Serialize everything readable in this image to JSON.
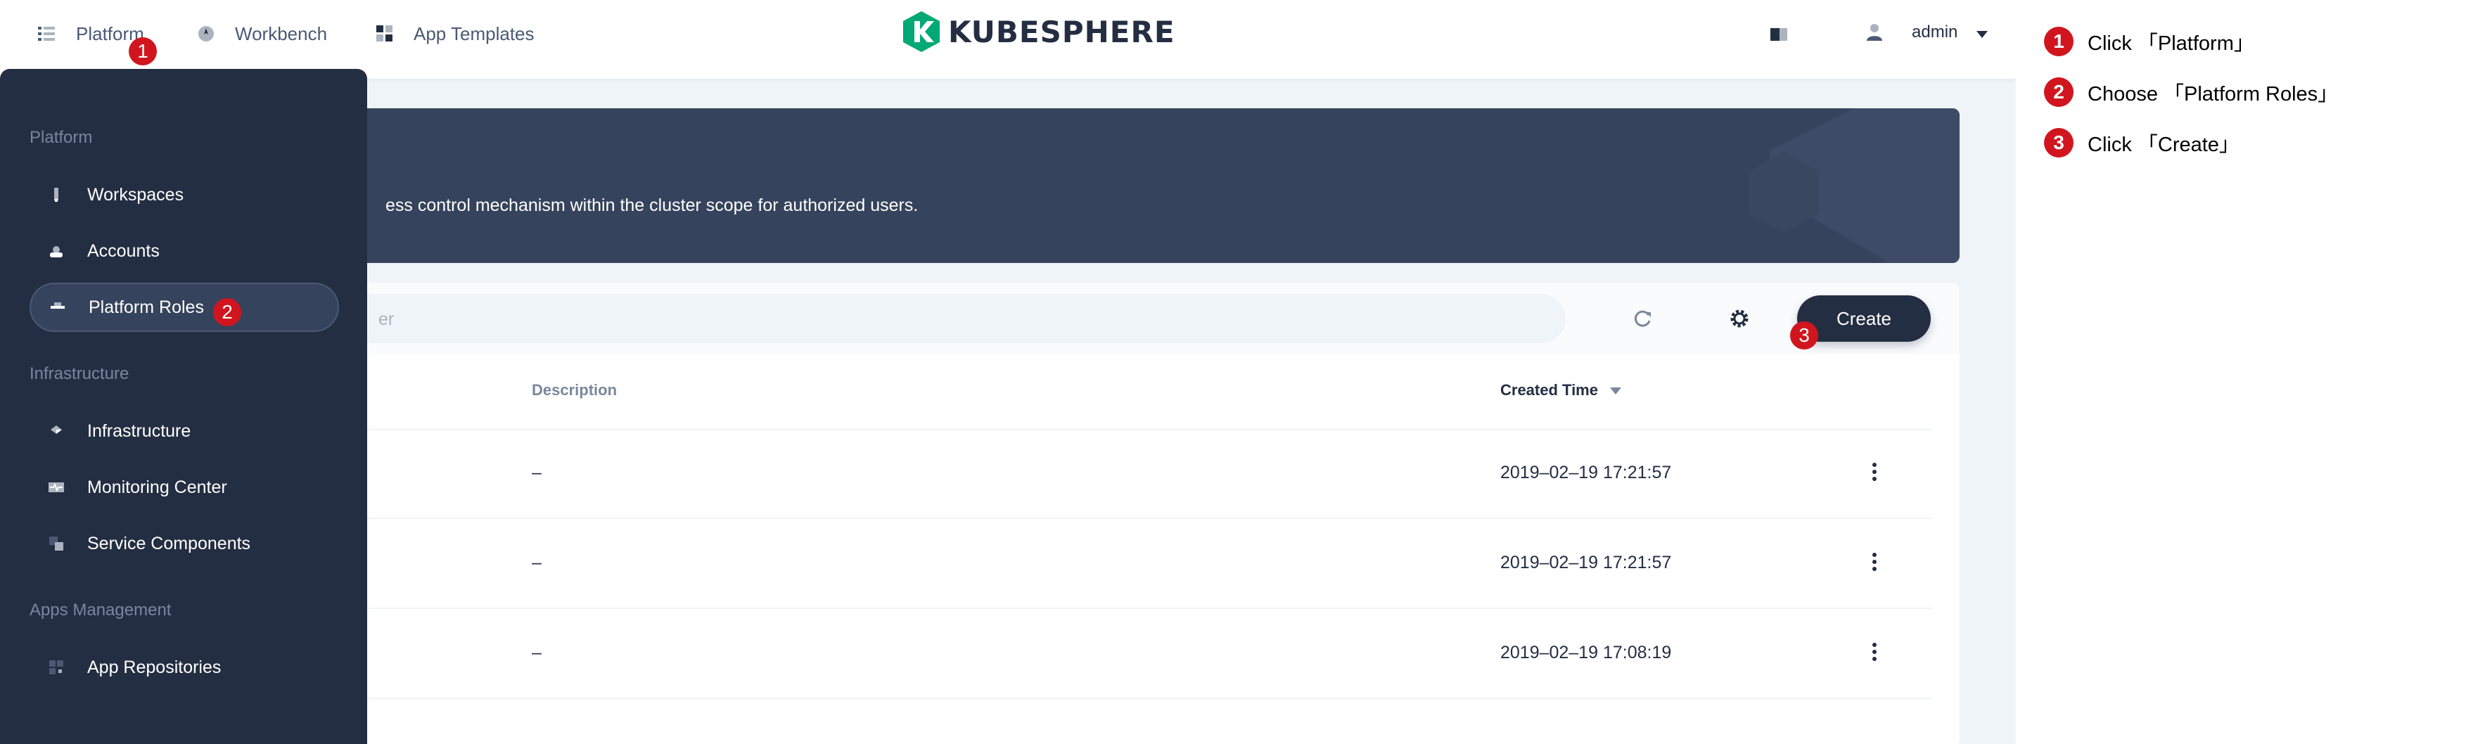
{
  "topnav": {
    "platform_label": "Platform",
    "workbench_label": "Workbench",
    "app_templates_label": "App Templates",
    "logo_text": "KUBESPHERE",
    "user_name": "admin"
  },
  "banner": {
    "description": "ess control mechanism within the cluster scope for authorized users."
  },
  "toolbar": {
    "search_placeholder": "er",
    "create_label": "Create"
  },
  "table": {
    "headers": {
      "description": "Description",
      "created_time": "Created Time"
    },
    "rows": [
      {
        "description": "–",
        "created_time": "2019–02–19 17:21:57"
      },
      {
        "description": "–",
        "created_time": "2019–02–19 17:21:57"
      },
      {
        "description": "–",
        "created_time": "2019–02–19 17:08:19"
      }
    ]
  },
  "sidebar": {
    "groups": [
      {
        "title": "Platform"
      },
      {
        "title": "Infrastructure"
      },
      {
        "title": "Apps Management"
      }
    ],
    "items": [
      {
        "label": "Workspaces",
        "icon": "workspace-icon"
      },
      {
        "label": "Accounts",
        "icon": "account-icon"
      },
      {
        "label": "Platform Roles",
        "icon": "role-icon"
      },
      {
        "label": "Infrastructure",
        "icon": "infrastructure-icon"
      },
      {
        "label": "Monitoring Center",
        "icon": "monitor-icon"
      },
      {
        "label": "Service Components",
        "icon": "components-icon"
      },
      {
        "label": "App Repositories",
        "icon": "repo-icon"
      }
    ]
  },
  "markers": [
    "1",
    "2",
    "3"
  ],
  "instructions": [
    {
      "num": "1",
      "text": "Click 「Platform」"
    },
    {
      "num": "2",
      "text": "Choose 「Platform Roles」"
    },
    {
      "num": "3",
      "text": "Click 「Create」"
    }
  ],
  "colors": {
    "dark": "#242e42",
    "banner": "#36435c",
    "marker": "#d1151e",
    "logo_green": "#00aa72",
    "background": "#eff4f9"
  }
}
